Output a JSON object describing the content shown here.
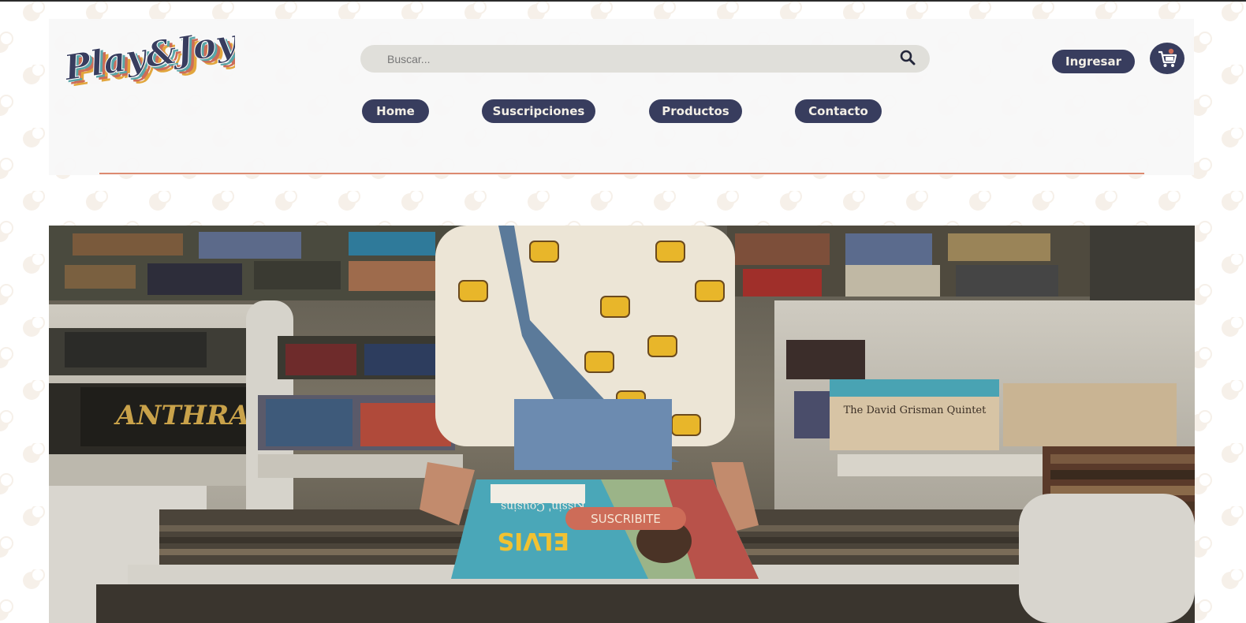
{
  "brand": {
    "logo_text": "Play&Joy"
  },
  "search": {
    "placeholder": "Buscar...",
    "icon": "search-icon"
  },
  "nav": {
    "items": [
      {
        "label": "Home"
      },
      {
        "label": "Suscripciones"
      },
      {
        "label": "Productos"
      },
      {
        "label": "Contacto"
      }
    ]
  },
  "account": {
    "login_label": "Ingresar",
    "cart_icon": "cart-icon"
  },
  "hero": {
    "cta_label": "SUSCRIBITE",
    "sign_anthrax": "ANTHRAX",
    "sign_quartet": "The David Grisman Quintet",
    "record_title": "ELVIS",
    "record_subtitle": "Kissin' Cousins"
  },
  "colors": {
    "navy": "#383d5e",
    "accent": "#cd6c58",
    "divider": "#dd8a70",
    "search_bg": "#e0dfda",
    "cream": "#f3efe6"
  }
}
